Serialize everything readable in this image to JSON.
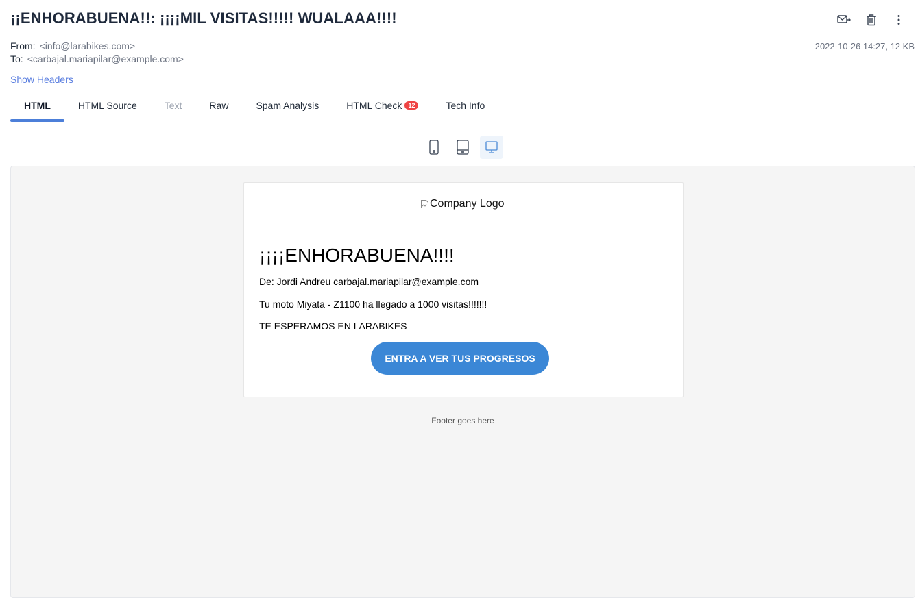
{
  "message": {
    "subject": "¡¡ENHORABUENA!!: ¡¡¡¡MIL VISITAS!!!!! WUALAAA!!!!",
    "from_label": "From:",
    "from_value": "<info@larabikes.com>",
    "to_label": "To:",
    "to_value": "<carbajal.mariapilar@example.com>",
    "date_size": "2022-10-26 14:27, 12 KB",
    "show_headers": "Show Headers"
  },
  "actions": {
    "forward_icon": "envelope-forward-icon",
    "delete_icon": "trash-icon",
    "more_icon": "vertical-dots-icon"
  },
  "tabs": [
    {
      "label": "HTML",
      "state": "active"
    },
    {
      "label": "HTML Source",
      "state": "normal"
    },
    {
      "label": "Text",
      "state": "disabled"
    },
    {
      "label": "Raw",
      "state": "normal"
    },
    {
      "label": "Spam Analysis",
      "state": "normal"
    },
    {
      "label": "HTML Check",
      "state": "normal",
      "badge": "12"
    },
    {
      "label": "Tech Info",
      "state": "normal"
    }
  ],
  "devices": [
    {
      "icon": "mobile-icon",
      "active": false
    },
    {
      "icon": "tablet-icon",
      "active": false
    },
    {
      "icon": "desktop-icon",
      "active": true
    }
  ],
  "email": {
    "logo_alt": "Company Logo",
    "heading": "¡¡¡¡ENHORABUENA!!!!",
    "from_line": "De: Jordi Andreu carbajal.mariapilar@example.com",
    "body_line": "Tu moto Miyata - Z1100 ha llegado a 1000 visitas!!!!!!!",
    "invite_line": "TE ESPERAMOS EN LARABIKES",
    "cta_label": "ENTRA A VER TUS PROGRESOS",
    "footer": "Footer goes here"
  },
  "colors": {
    "accent": "#4c7fd9",
    "link": "#5b7fe0",
    "badge": "#ef4444",
    "cta": "#3b87d6",
    "preview_bg": "#f5f5f5"
  }
}
